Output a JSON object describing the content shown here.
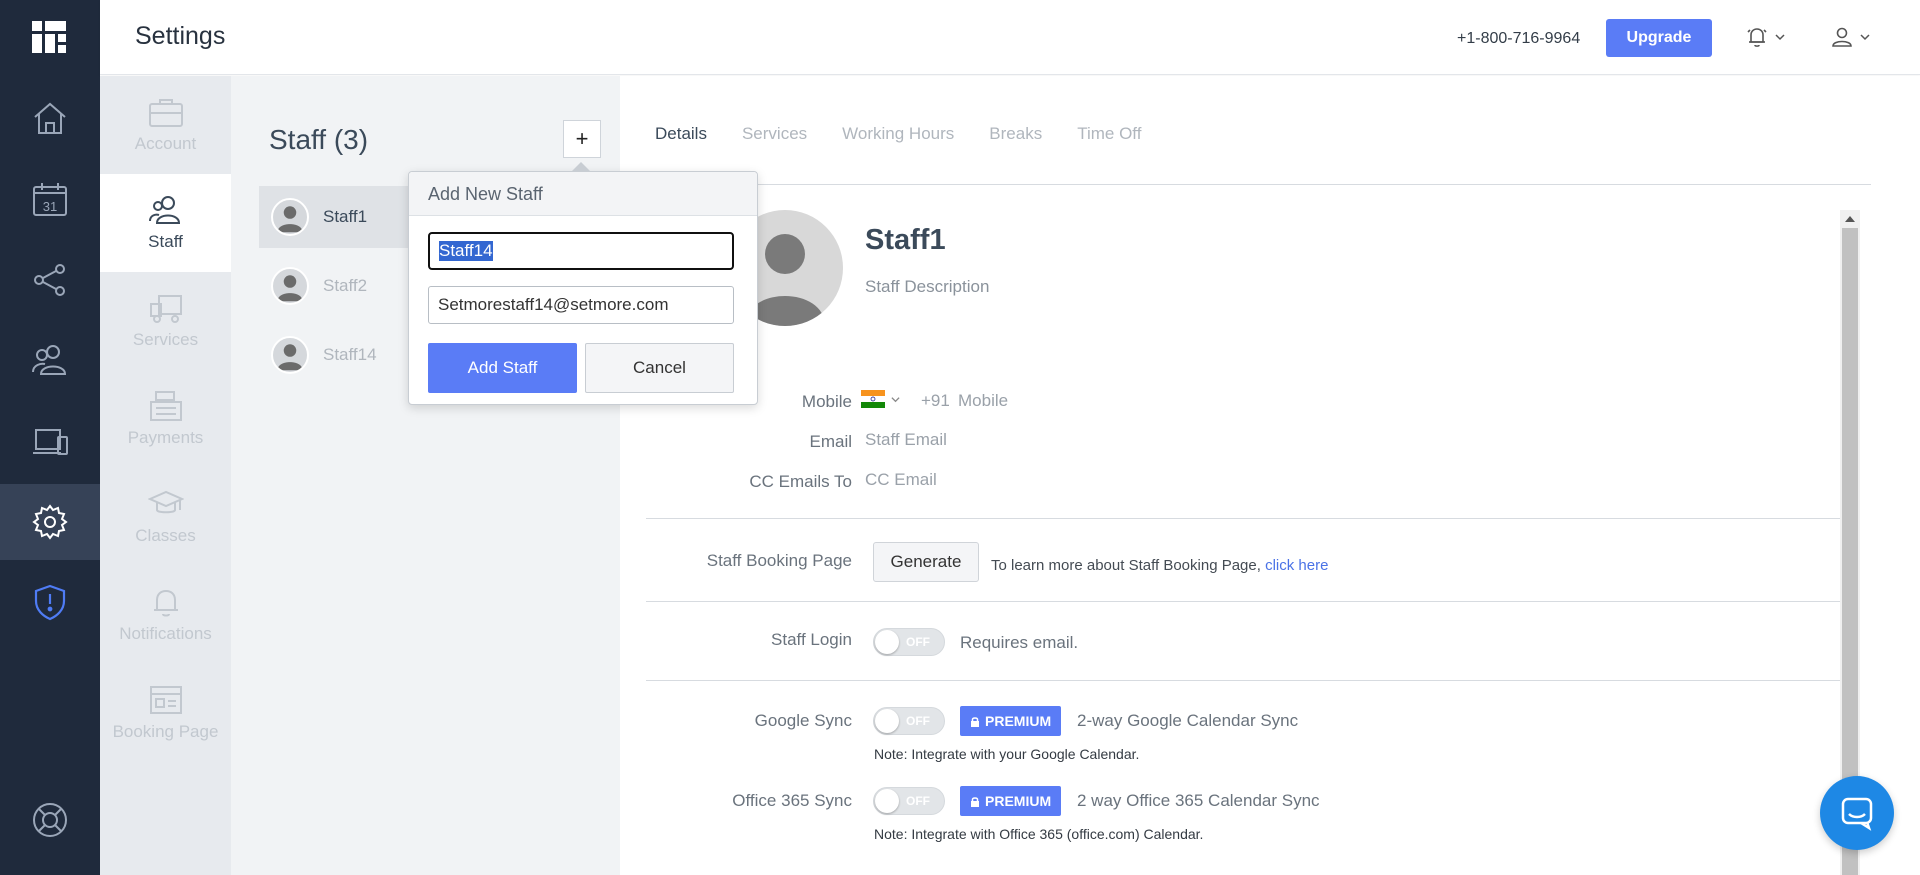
{
  "header": {
    "title": "Settings",
    "phone": "+1-800-716-9964",
    "upgrade_label": "Upgrade"
  },
  "rail": {
    "items": [
      "home-icon",
      "calendar-icon",
      "share-icon",
      "users-icon",
      "devices-icon",
      "gear-icon",
      "shield-icon",
      "help-icon"
    ],
    "calendar_day": "31"
  },
  "settings_nav": {
    "items": [
      {
        "label": "Account"
      },
      {
        "label": "Staff"
      },
      {
        "label": "Services"
      },
      {
        "label": "Payments"
      },
      {
        "label": "Classes"
      },
      {
        "label": "Notifications"
      },
      {
        "label": "Booking Page"
      }
    ],
    "active": "Staff"
  },
  "staff_list": {
    "heading": "Staff (3)",
    "add_symbol": "+",
    "items": [
      "Staff1",
      "Staff2",
      "Staff14"
    ]
  },
  "popup": {
    "title": "Add New Staff",
    "name_value": "Staff14",
    "email_value": "Setmorestaff14@setmore.com",
    "add_label": "Add Staff",
    "cancel_label": "Cancel"
  },
  "tabs": [
    "Details",
    "Services",
    "Working Hours",
    "Breaks",
    "Time Off"
  ],
  "details": {
    "name": "Staff1",
    "description": "Staff Description",
    "mobile_label": "Mobile",
    "mobile_code": "+91",
    "mobile_placeholder": "Mobile",
    "email_label": "Email",
    "email_placeholder": "Staff Email",
    "cc_label": "CC Emails To",
    "cc_placeholder": "CC Email",
    "booking_label": "Staff Booking Page",
    "generate_label": "Generate",
    "booking_info": "To learn more about Staff Booking Page,",
    "booking_link": "click here",
    "login_label": "Staff Login",
    "login_toggle": "OFF",
    "login_note": "Requires email.",
    "google_label": "Google Sync",
    "google_toggle": "OFF",
    "google_badge": "PREMIUM",
    "google_desc": "2-way Google Calendar Sync",
    "google_note": "Note: Integrate with your Google Calendar.",
    "office_label": "Office 365 Sync",
    "office_toggle": "OFF",
    "office_badge": "PREMIUM",
    "office_desc": "2 way Office 365 Calendar Sync",
    "office_note": "Note: Integrate with Office 365 (office.com) Calendar."
  },
  "colors": {
    "rail": "#1f2a3c",
    "accent": "#5a7cf6",
    "link": "#4a72e6",
    "chat": "#1e88e5"
  }
}
